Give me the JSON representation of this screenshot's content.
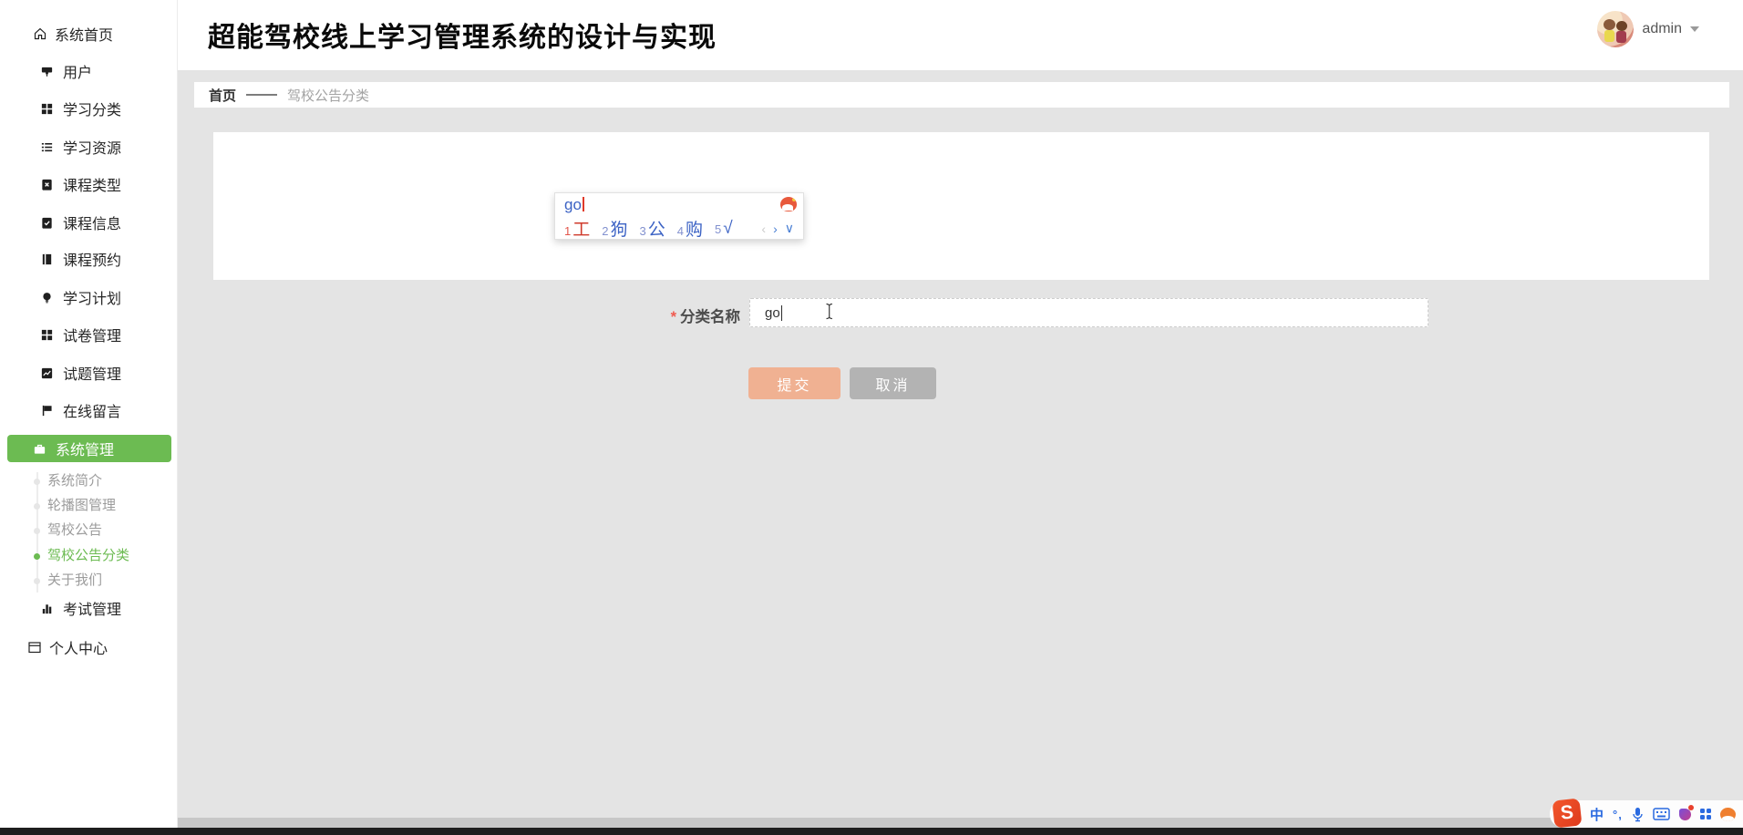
{
  "header": {
    "title": "超能驾校线上学习管理系统的设计与实现",
    "user": {
      "name": "admin"
    }
  },
  "sidebar": {
    "items": [
      {
        "label": "系统首页"
      },
      {
        "label": "用户"
      },
      {
        "label": "学习分类"
      },
      {
        "label": "学习资源"
      },
      {
        "label": "课程类型"
      },
      {
        "label": "课程信息"
      },
      {
        "label": "课程预约"
      },
      {
        "label": "学习计划"
      },
      {
        "label": "试卷管理"
      },
      {
        "label": "试题管理"
      },
      {
        "label": "在线留言"
      },
      {
        "label": "系统管理"
      }
    ],
    "submenu": [
      {
        "label": "系统简介"
      },
      {
        "label": "轮播图管理"
      },
      {
        "label": "驾校公告"
      },
      {
        "label": "驾校公告分类"
      },
      {
        "label": "关于我们"
      }
    ],
    "exam": {
      "label": "考试管理"
    },
    "personal": {
      "label": "个人中心"
    }
  },
  "breadcrumb": {
    "home": "首页",
    "current": "驾校公告分类"
  },
  "form": {
    "required_mark": "*",
    "label": "分类名称",
    "input_value": "go",
    "submit_label": "提交",
    "cancel_label": "取消"
  },
  "ime": {
    "composition": "go",
    "candidates": [
      {
        "num": "1",
        "text": "工"
      },
      {
        "num": "2",
        "text": "狗"
      },
      {
        "num": "3",
        "text": "公"
      },
      {
        "num": "4",
        "text": "购"
      },
      {
        "num": "5",
        "text": "√"
      }
    ],
    "prev": "‹",
    "next": "›",
    "expand": "∨"
  },
  "taskbar": {
    "logo_letter": "S",
    "mode": "中",
    "punct": "°,"
  },
  "colors": {
    "accent_green": "#6cbb52",
    "submit_button": "#f0b192",
    "cancel_button": "#b3b3b3",
    "candidate_selected": "#cf3a2b",
    "candidate_normal": "#3b62c4",
    "content_background": "#e4e4e4"
  }
}
